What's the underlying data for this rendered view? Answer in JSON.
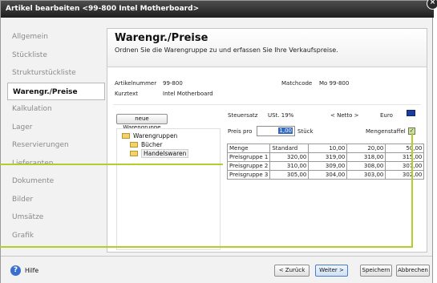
{
  "window": {
    "title": "Artikel bearbeiten <99-800 Intel Motherboard>",
    "close_symbol": "×"
  },
  "sidebar": {
    "items": [
      {
        "label": "Allgemein",
        "active": false
      },
      {
        "label": "Stückliste",
        "active": false
      },
      {
        "label": "Strukturstückliste",
        "active": false
      },
      {
        "label": "Warengr./Preise",
        "active": true
      },
      {
        "label": "Kalkulation",
        "active": false
      },
      {
        "label": "Lager",
        "active": false
      },
      {
        "label": "Reservierungen",
        "active": false
      },
      {
        "label": "Lieferanten",
        "active": false
      },
      {
        "label": "Dokumente",
        "active": false
      },
      {
        "label": "Bilder",
        "active": false
      },
      {
        "label": "Umsätze",
        "active": false
      },
      {
        "label": "Grafik",
        "active": false
      }
    ]
  },
  "main": {
    "title": "Warengr./Preise",
    "subtitle": "Ordnen Sie die Warengruppe zu und erfassen Sie Ihre Verkaufspreise.",
    "info": {
      "artikelnummer_label": "Artikelnummer",
      "artikelnummer_value": "99-800",
      "matchcode_label": "Matchcode",
      "matchcode_value": "Mo 99-800",
      "kurztext_label": "Kurztext",
      "kurztext_value": "Intel Motherboard"
    },
    "new_group_button": "neue Warengruppe",
    "tree": {
      "root": "Warengruppen",
      "children": [
        "Bücher",
        "Handelswaren"
      ],
      "selected": "Handelswaren"
    },
    "prices": {
      "steuersatz_label": "Steuersatz",
      "steuersatz_value": "USt. 19%",
      "netto_label": "< Netto >",
      "currency": "Euro",
      "preis_pro_label": "Preis pro",
      "preis_pro_value": "1,00",
      "unit": "Stück",
      "mengenstaffel_label": "Mengenstaffel",
      "mengenstaffel_checked": true,
      "table": {
        "header": [
          "Menge",
          "Standard",
          "10,00",
          "20,00",
          "50,00"
        ],
        "rows": [
          [
            "Preisgruppe 1",
            "320,00",
            "319,00",
            "318,00",
            "315,00"
          ],
          [
            "Preisgruppe 2",
            "310,00",
            "309,00",
            "308,00",
            "307,00"
          ],
          [
            "Preisgruppe 3",
            "305,00",
            "304,00",
            "303,00",
            "302,00"
          ]
        ]
      }
    }
  },
  "footer": {
    "help_label": "Hilfe",
    "back_button": "< Zurück",
    "next_button": "Weiter >",
    "save_button": "Speichern",
    "cancel_button": "Abbrechen"
  },
  "colors": {
    "titlebar": "#2a2a2a",
    "accent_callout": "#b5cc2b",
    "primary_button_border": "#4a7ec0"
  }
}
